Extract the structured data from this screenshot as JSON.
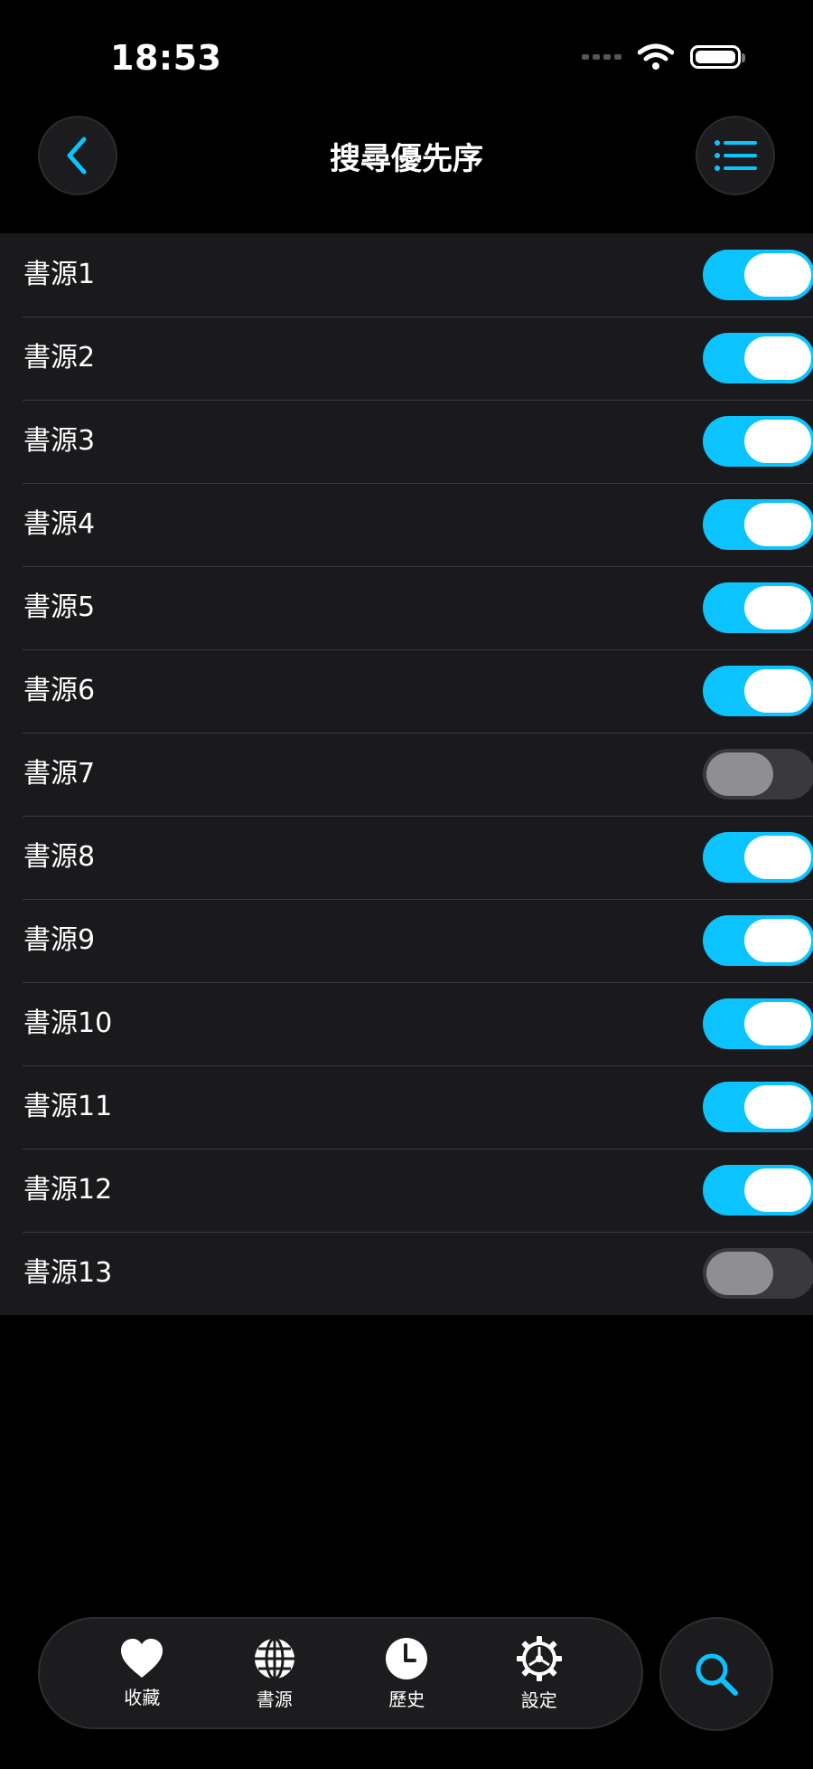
{
  "status_bar": {
    "time": "18:53"
  },
  "nav": {
    "title": "搜尋優先序",
    "back_icon": "chevron-left-icon",
    "menu_icon": "list-icon"
  },
  "colors": {
    "accent": "#0ac3ff",
    "toggle_off": "#3a3a3c",
    "row_bg": "#1a1a1c"
  },
  "sources": [
    {
      "label": "書源1",
      "enabled": true
    },
    {
      "label": "書源2",
      "enabled": true
    },
    {
      "label": "書源3",
      "enabled": true
    },
    {
      "label": "書源4",
      "enabled": true
    },
    {
      "label": "書源5",
      "enabled": true
    },
    {
      "label": "書源6",
      "enabled": true
    },
    {
      "label": "書源7",
      "enabled": false
    },
    {
      "label": "書源8",
      "enabled": true
    },
    {
      "label": "書源9",
      "enabled": true
    },
    {
      "label": "書源10",
      "enabled": true
    },
    {
      "label": "書源11",
      "enabled": true
    },
    {
      "label": "書源12",
      "enabled": true
    },
    {
      "label": "書源13",
      "enabled": false
    }
  ],
  "tab_bar": {
    "items": [
      {
        "label": "收藏",
        "icon": "heart-icon"
      },
      {
        "label": "書源",
        "icon": "globe-icon"
      },
      {
        "label": "歷史",
        "icon": "clock-icon"
      },
      {
        "label": "設定",
        "icon": "gear-icon"
      }
    ],
    "search_icon": "search-icon"
  }
}
